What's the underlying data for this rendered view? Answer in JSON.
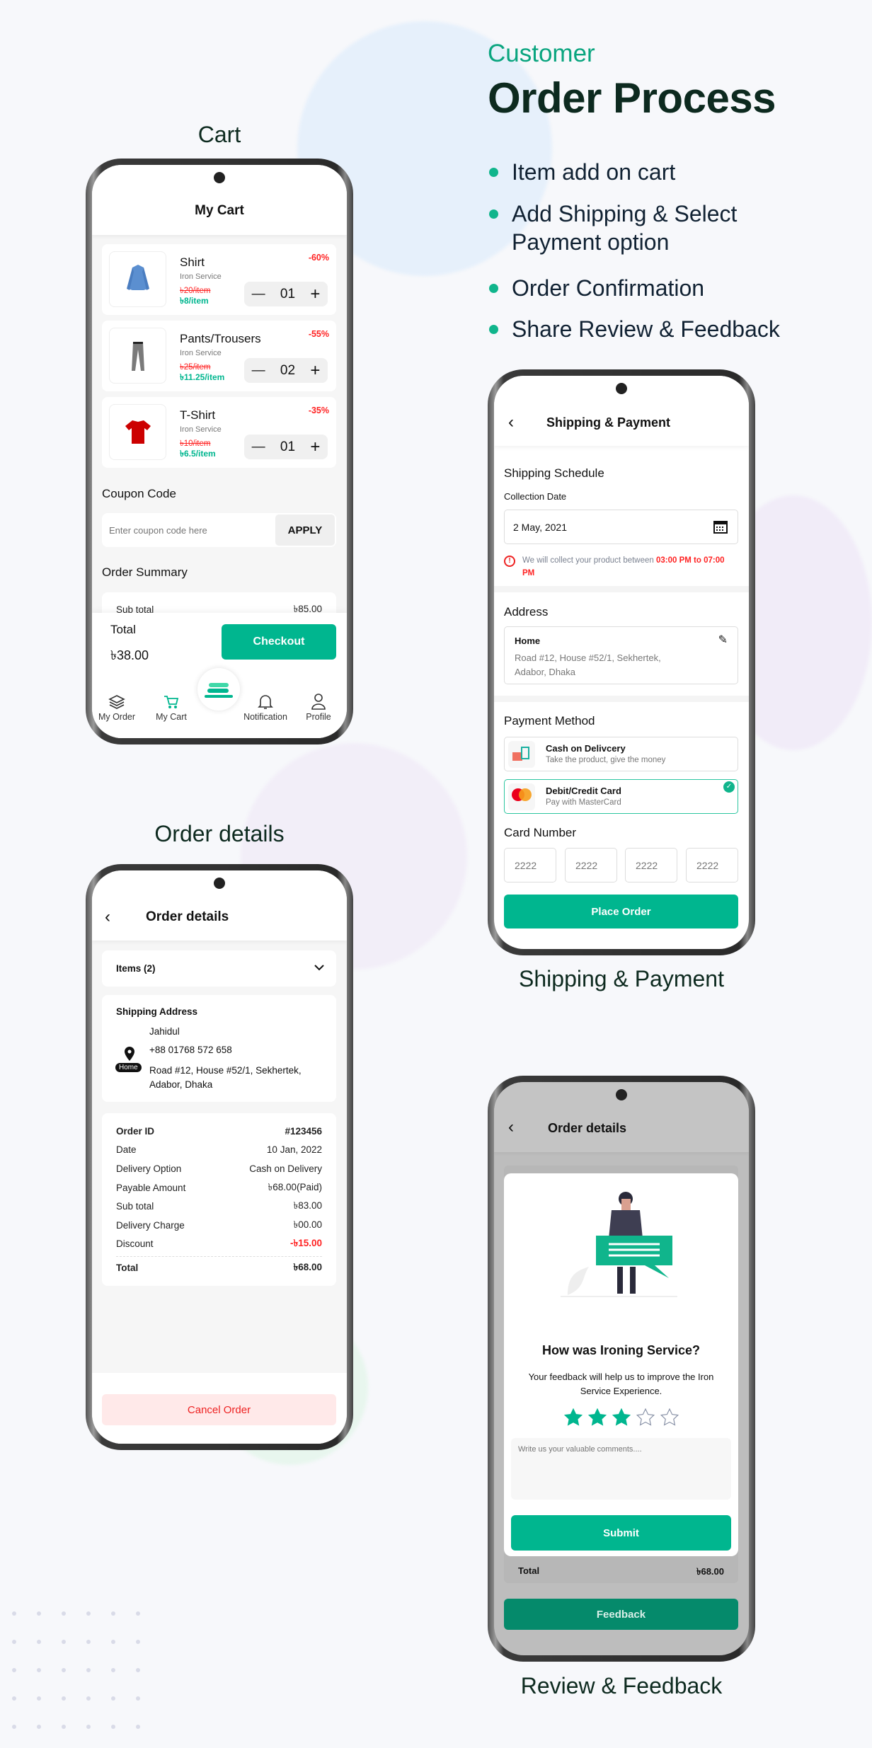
{
  "header": {
    "kicker": "Customer",
    "title": "Order Process"
  },
  "bullets": [
    "Item add on cart",
    "Add Shipping & Select Payment option",
    "Order Confirmation",
    "Share Review & Feedback"
  ],
  "labels": {
    "cart": "Cart",
    "order_details": "Order details",
    "shipping": "Shipping & Payment",
    "review": "Review & Feedback"
  },
  "colors": {
    "accent": "#00b68f",
    "discount": "#ff2222"
  },
  "cart": {
    "title": "My Cart",
    "items": [
      {
        "name": "Shirt",
        "service": "Iron Service",
        "old_price": "৳20/item",
        "price": "৳8/item",
        "discount": "-60%",
        "qty": "01"
      },
      {
        "name": "Pants/Trousers",
        "service": "Iron Service",
        "old_price": "৳25/item",
        "price": "৳11.25/item",
        "discount": "-55%",
        "qty": "02"
      },
      {
        "name": "T-Shirt",
        "service": "Iron Service",
        "old_price": "৳10/item",
        "price": "৳6.5/item",
        "discount": "-35%",
        "qty": "01"
      }
    ],
    "coupon_title": "Coupon Code",
    "coupon_placeholder": "Enter coupon code here",
    "apply": "APPLY",
    "summary_title": "Order Summary",
    "subtotal_label": "Sub total",
    "subtotal_value": "৳85.00",
    "total_label": "Total",
    "total_value": "৳38.00",
    "checkout": "Checkout",
    "nav": [
      "My Order",
      "My Cart",
      "Notification",
      "Profile"
    ]
  },
  "order": {
    "title": "Order details",
    "items": "Items (2)",
    "ship_title": "Shipping Address",
    "name": "Jahidul",
    "phone": "+88 01768 572 658",
    "address": "Road #12, House #52/1, Sekhertek, Adabor, Dhaka",
    "badge": "Home",
    "rows": [
      [
        "Order ID",
        "#123456"
      ],
      [
        "Date",
        "10 Jan, 2022"
      ],
      [
        "Delivery Option",
        "Cash on Delivery"
      ],
      [
        "Payable Amount",
        "৳68.00(Paid)"
      ],
      [
        "Sub total",
        "৳83.00"
      ],
      [
        "Delivery Charge",
        "৳00.00"
      ],
      [
        "Discount",
        "-৳15.00"
      ]
    ],
    "total_label": "Total",
    "total_value": "৳68.00",
    "cancel": "Cancel Order"
  },
  "shipping": {
    "title": "Shipping & Payment",
    "schedule": "Shipping Schedule",
    "collection": "Collection Date",
    "date": "2 May, 2021",
    "note": "We will collect your product between ",
    "note_time": "03:00 PM to 07:00 PM",
    "address_title": "Address",
    "addr_label": "Home",
    "addr": "Road #12, House #52/1, Sekhertek, Adabor, Dhaka",
    "payment_title": "Payment Method",
    "cod": "Cash on Delivcery",
    "cod_sub": "Take the product, give the money",
    "card": "Debit/Credit Card",
    "card_sub": "Pay with MasterCard",
    "card_number": "Card Number",
    "card_placeholder": "2222",
    "place": "Place Order"
  },
  "review": {
    "title": "Order details",
    "question": "How was Ironing Service?",
    "sub": "Your feedback will help us to improve the Iron Service Experience.",
    "rating": 3,
    "max_rating": 5,
    "placeholder": "Write us your valuable comments....",
    "submit": "Submit",
    "total_label": "Total",
    "total_value": "৳68.00",
    "feedback": "Feedback"
  }
}
